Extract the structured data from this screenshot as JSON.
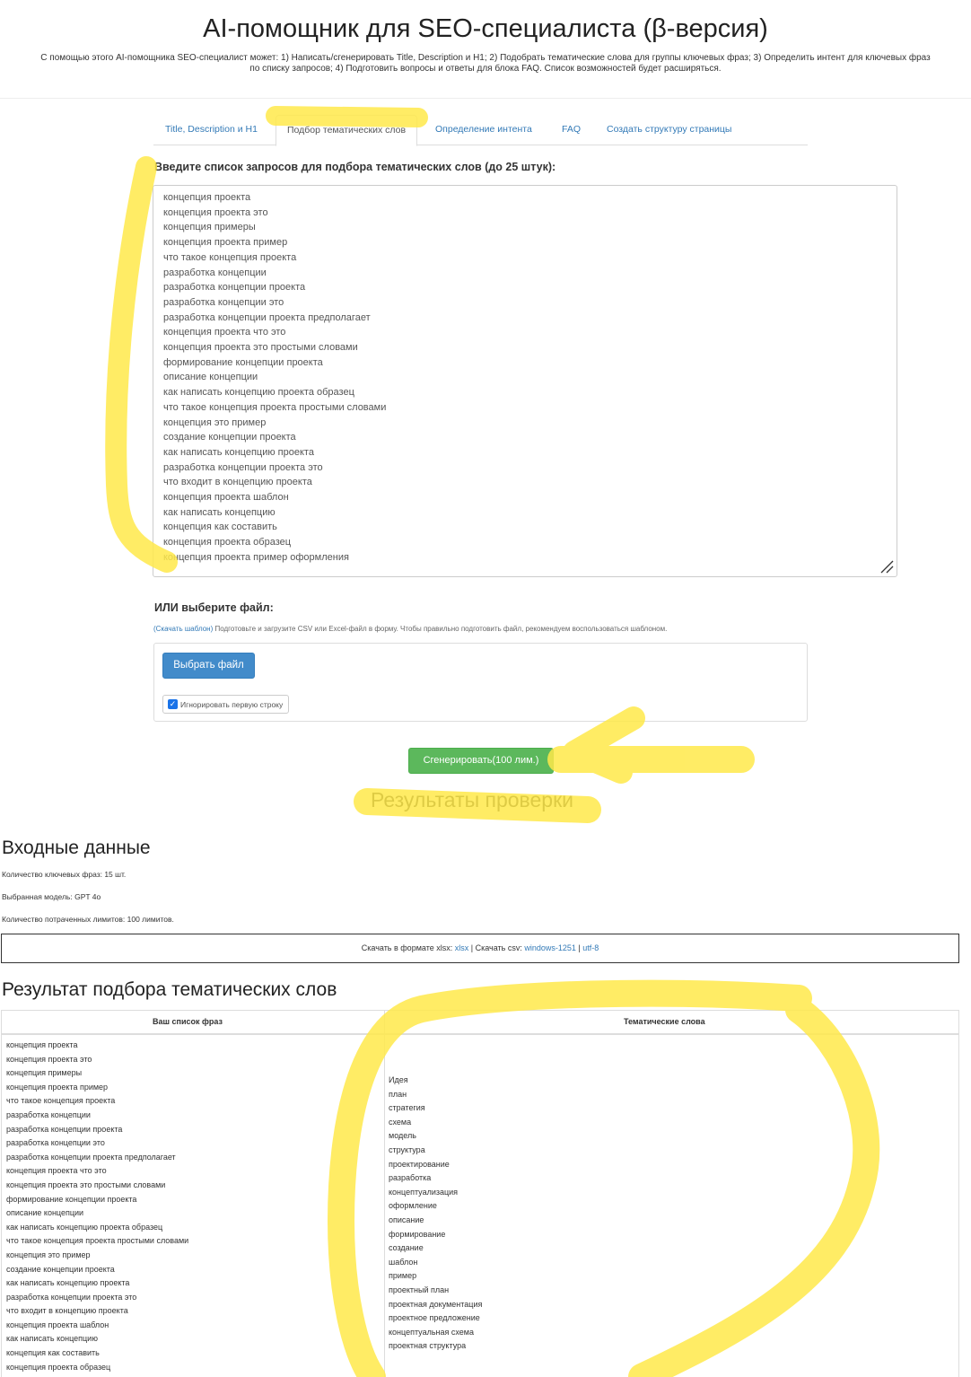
{
  "page": {
    "title": "AI-помощник для SEO-специалиста (β-версия)",
    "intro_line1": "С помощью этого AI-помощника SEO-специалист может: 1) Написать/сгенерировать Title, Description и H1; 2) Подобрать тематические слова для группы ключевых фраз; 3) Определить интент для ключевых фраз",
    "intro_line2": "по списку запросов; 4) Подготовить вопросы и ответы для блока FAQ. Список возможностей будет расширяться."
  },
  "tabs": [
    {
      "label": "Title, Description и H1",
      "active": false
    },
    {
      "label": "Подбор тематических слов",
      "active": true
    },
    {
      "label": "Определение интента",
      "active": false
    },
    {
      "label": "FAQ",
      "active": false
    },
    {
      "label": "Создать структуру страницы",
      "active": false
    }
  ],
  "form": {
    "queries_label": "Введите список запросов для подбора тематических слов (до 25 штук):",
    "queries": [
      "концепция проекта",
      "концепция проекта это",
      "концепция примеры",
      "концепция проекта пример",
      "что такое концепция проекта",
      "разработка концепции",
      "разработка концепции проекта",
      "разработка концепции это",
      "разработка концепции проекта предполагает",
      "концепция проекта что это",
      "концепция проекта это простыми словами",
      "формирование концепции проекта",
      "описание концепции",
      "как написать концепцию проекта образец",
      "что такое концепция проекта простыми словами",
      "концепция это пример",
      "создание концепции проекта",
      "как написать концепцию проекта",
      "разработка концепции проекта это",
      "что входит в концепцию проекта",
      "концепция проекта шаблон",
      "как написать концепцию",
      "концепция как составить",
      "концепция проекта образец",
      "концепция проекта пример оформления"
    ],
    "file_label": "ИЛИ выберите файл:",
    "template_link": "(Скачать шаблон)",
    "file_help": " Подготовьте и загрузите CSV или Excel-файл в форму. Чтобы правильно подготовить файл, рекомендуем воспользоваться шаблоном.",
    "choose_file_button": "Выбрать файл",
    "ignore_first_row_label": "Игнорировать первую строку",
    "ignore_first_row_checked": true,
    "generate_button": "Сгенерировать(100 лим.)"
  },
  "results_check_label": "Результаты проверки",
  "input_data": {
    "heading": "Входные данные",
    "keyword_count": "Количество ключевых фраз: 15 шт.",
    "model": "Выбранная модель: GPT 4o",
    "limits_spent": "Количество потраченных лимитов: 100 лимитов."
  },
  "download": {
    "xlsx_prefix": "Скачать в формате xlsx: ",
    "xlsx_link": "xlsx",
    "csv_prefix": " | Скачать csv: ",
    "csv_win_link": "windows-1251",
    "separator": " | ",
    "csv_utf_link": "utf-8"
  },
  "results": {
    "heading": "Результат подбора тематических слов",
    "col1_header": "Ваш список фраз",
    "col2_header": "Тематические слова",
    "phrases": [
      "концепция проекта",
      "концепция проекта это",
      "концепция примеры",
      "концепция проекта пример",
      "что такое концепция проекта",
      "разработка концепции",
      "разработка концепции проекта",
      "разработка концепции это",
      "разработка концепции проекта предполагает",
      "концепция проекта что это",
      "концепция проекта это простыми словами",
      "формирование концепции проекта",
      "описание концепции",
      "как написать концепцию проекта образец",
      "что такое концепция проекта простыми словами",
      "концепция это пример",
      "создание концепции проекта",
      "как написать концепцию проекта",
      "разработка концепции проекта это",
      "что входит в концепцию проекта",
      "концепция проекта шаблон",
      "как написать концепцию",
      "концепция как составить",
      "концепция проекта образец"
    ],
    "thematic_words": [
      "Идея",
      "план",
      "стратегия",
      "схема",
      "модель",
      "структура",
      "проектирование",
      "разработка",
      "концептуализация",
      "оформление",
      "описание",
      "формирование",
      "создание",
      "шаблон",
      "пример",
      "проектный план",
      "проектная документация",
      "проектное предложение",
      "концептуальная схема",
      "проектная структура"
    ]
  },
  "colors": {
    "link": "#337ab7",
    "primary_button": "#428bca",
    "success_button": "#5cb85c",
    "highlighter": "#ffe94a"
  }
}
